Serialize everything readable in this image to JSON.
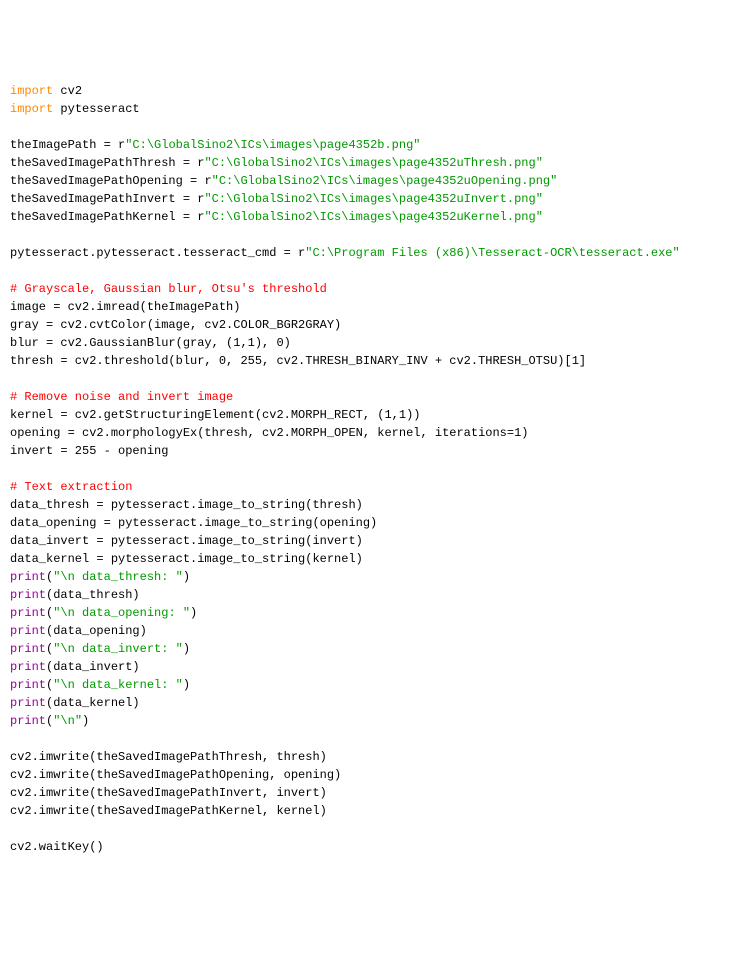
{
  "lines": [
    {
      "parts": [
        {
          "cls": "kw-import",
          "t": "import"
        },
        {
          "cls": "code",
          "t": " cv2"
        }
      ]
    },
    {
      "parts": [
        {
          "cls": "kw-import",
          "t": "import"
        },
        {
          "cls": "code",
          "t": " pytesseract"
        }
      ]
    },
    {
      "parts": []
    },
    {
      "parts": [
        {
          "cls": "code",
          "t": "theImagePath = "
        },
        {
          "cls": "rprefix",
          "t": "r"
        },
        {
          "cls": "str",
          "t": "\"C:\\GlobalSino2\\ICs\\images\\page4352b.png\""
        }
      ]
    },
    {
      "parts": [
        {
          "cls": "code",
          "t": "theSavedImagePathThresh = "
        },
        {
          "cls": "rprefix",
          "t": "r"
        },
        {
          "cls": "str",
          "t": "\"C:\\GlobalSino2\\ICs\\images\\page4352uThresh.png\""
        }
      ]
    },
    {
      "parts": [
        {
          "cls": "code",
          "t": "theSavedImagePathOpening = "
        },
        {
          "cls": "rprefix",
          "t": "r"
        },
        {
          "cls": "str",
          "t": "\"C:\\GlobalSino2\\ICs\\images\\page4352uOpening.png\""
        }
      ]
    },
    {
      "parts": [
        {
          "cls": "code",
          "t": "theSavedImagePathInvert = "
        },
        {
          "cls": "rprefix",
          "t": "r"
        },
        {
          "cls": "str",
          "t": "\"C:\\GlobalSino2\\ICs\\images\\page4352uInvert.png\""
        }
      ]
    },
    {
      "parts": [
        {
          "cls": "code",
          "t": "theSavedImagePathKernel = "
        },
        {
          "cls": "rprefix",
          "t": "r"
        },
        {
          "cls": "str",
          "t": "\"C:\\GlobalSino2\\ICs\\images\\page4352uKernel.png\""
        }
      ]
    },
    {
      "parts": []
    },
    {
      "parts": [
        {
          "cls": "code",
          "t": "pytesseract.pytesseract.tesseract_cmd = "
        },
        {
          "cls": "rprefix",
          "t": "r"
        },
        {
          "cls": "str",
          "t": "\"C:\\Program Files (x86)\\Tesseract-OCR\\tesseract.exe\""
        }
      ]
    },
    {
      "parts": []
    },
    {
      "parts": [
        {
          "cls": "comment",
          "t": "# Grayscale, Gaussian blur, Otsu's threshold"
        }
      ]
    },
    {
      "parts": [
        {
          "cls": "code",
          "t": "image = cv2.imread(theImagePath)"
        }
      ]
    },
    {
      "parts": [
        {
          "cls": "code",
          "t": "gray = cv2.cvtColor(image, cv2.COLOR_BGR2GRAY)"
        }
      ]
    },
    {
      "parts": [
        {
          "cls": "code",
          "t": "blur = cv2.GaussianBlur(gray, (1,1), 0)"
        }
      ]
    },
    {
      "parts": [
        {
          "cls": "code",
          "t": "thresh = cv2.threshold(blur, 0, 255, cv2.THRESH_BINARY_INV + cv2.THRESH_OTSU)[1]"
        }
      ]
    },
    {
      "parts": []
    },
    {
      "parts": [
        {
          "cls": "comment",
          "t": "# Remove noise and invert image"
        }
      ]
    },
    {
      "parts": [
        {
          "cls": "code",
          "t": "kernel = cv2.getStructuringElement(cv2.MORPH_RECT, (1,1))"
        }
      ]
    },
    {
      "parts": [
        {
          "cls": "code",
          "t": "opening = cv2.morphologyEx(thresh, cv2.MORPH_OPEN, kernel, iterations=1)"
        }
      ]
    },
    {
      "parts": [
        {
          "cls": "code",
          "t": "invert = 255 - opening"
        }
      ]
    },
    {
      "parts": []
    },
    {
      "parts": [
        {
          "cls": "comment",
          "t": "# Text extraction"
        }
      ]
    },
    {
      "parts": [
        {
          "cls": "code",
          "t": "data_thresh = pytesseract.image_to_string(thresh)"
        }
      ]
    },
    {
      "parts": [
        {
          "cls": "code",
          "t": "data_opening = pytesseract.image_to_string(opening)"
        }
      ]
    },
    {
      "parts": [
        {
          "cls": "code",
          "t": "data_invert = pytesseract.image_to_string(invert)"
        }
      ]
    },
    {
      "parts": [
        {
          "cls": "code",
          "t": "data_kernel = pytesseract.image_to_string(kernel)"
        }
      ]
    },
    {
      "parts": [
        {
          "cls": "kw-print",
          "t": "print"
        },
        {
          "cls": "code",
          "t": "("
        },
        {
          "cls": "str",
          "t": "\"\\n data_thresh: \""
        },
        {
          "cls": "code",
          "t": ")"
        }
      ]
    },
    {
      "parts": [
        {
          "cls": "kw-print",
          "t": "print"
        },
        {
          "cls": "code",
          "t": "(data_thresh)"
        }
      ]
    },
    {
      "parts": [
        {
          "cls": "kw-print",
          "t": "print"
        },
        {
          "cls": "code",
          "t": "("
        },
        {
          "cls": "str",
          "t": "\"\\n data_opening: \""
        },
        {
          "cls": "code",
          "t": ")"
        }
      ]
    },
    {
      "parts": [
        {
          "cls": "kw-print",
          "t": "print"
        },
        {
          "cls": "code",
          "t": "(data_opening)"
        }
      ]
    },
    {
      "parts": [
        {
          "cls": "kw-print",
          "t": "print"
        },
        {
          "cls": "code",
          "t": "("
        },
        {
          "cls": "str",
          "t": "\"\\n data_invert: \""
        },
        {
          "cls": "code",
          "t": ")"
        }
      ]
    },
    {
      "parts": [
        {
          "cls": "kw-print",
          "t": "print"
        },
        {
          "cls": "code",
          "t": "(data_invert)"
        }
      ]
    },
    {
      "parts": [
        {
          "cls": "kw-print",
          "t": "print"
        },
        {
          "cls": "code",
          "t": "("
        },
        {
          "cls": "str",
          "t": "\"\\n data_kernel: \""
        },
        {
          "cls": "code",
          "t": ")"
        }
      ]
    },
    {
      "parts": [
        {
          "cls": "kw-print",
          "t": "print"
        },
        {
          "cls": "code",
          "t": "(data_kernel)"
        }
      ]
    },
    {
      "parts": [
        {
          "cls": "kw-print",
          "t": "print"
        },
        {
          "cls": "code",
          "t": "("
        },
        {
          "cls": "str",
          "t": "\"\\n\""
        },
        {
          "cls": "code",
          "t": ")"
        }
      ]
    },
    {
      "parts": []
    },
    {
      "parts": [
        {
          "cls": "code",
          "t": "cv2.imwrite(theSavedImagePathThresh, thresh)"
        }
      ]
    },
    {
      "parts": [
        {
          "cls": "code",
          "t": "cv2.imwrite(theSavedImagePathOpening, opening)"
        }
      ]
    },
    {
      "parts": [
        {
          "cls": "code",
          "t": "cv2.imwrite(theSavedImagePathInvert, invert)"
        }
      ]
    },
    {
      "parts": [
        {
          "cls": "code",
          "t": "cv2.imwrite(theSavedImagePathKernel, kernel)"
        }
      ]
    },
    {
      "parts": []
    },
    {
      "parts": [
        {
          "cls": "code",
          "t": "cv2.waitKey()"
        }
      ]
    }
  ]
}
